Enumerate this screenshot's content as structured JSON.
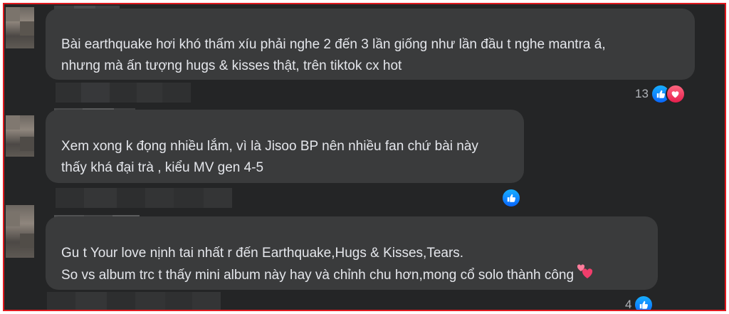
{
  "comments": [
    {
      "lines": [
        "Bài earthquake hơi khó thấm xíu phải nghe 2 đến 3 lần giống như lần đầu t nghe mantra á,",
        "nhưng mà ấn tượng hugs & kisses thật, trên tiktok cx hot"
      ],
      "reaction_count": "13",
      "reactions": [
        "like-icon",
        "heart-icon"
      ]
    },
    {
      "lines": [
        "Xem xong k đọng nhiều lắm, vì là Jisoo BP nên nhiều fan chứ bài này",
        "thấy khá đại trà , kiểu MV gen 4-5"
      ],
      "reaction_count": "",
      "reactions": [
        "like-icon"
      ]
    },
    {
      "lines": [
        "Gu t Your love nịnh tai nhất r đến Earthquake,Hugs & Kisses,Tears.",
        "So vs album trc t thấy mini album này hay và chỉnh chu hơn,mong cổ solo thành công"
      ],
      "reaction_count": "4",
      "reactions": [
        "like-icon"
      ]
    }
  ],
  "colors": {
    "background": "#242526",
    "bubble": "#3a3b3c",
    "text": "#e4e6eb",
    "muted": "#b0b3b8",
    "like": "#0866ff",
    "heart": "#e61e4d",
    "frame_border": "#e0191e"
  }
}
